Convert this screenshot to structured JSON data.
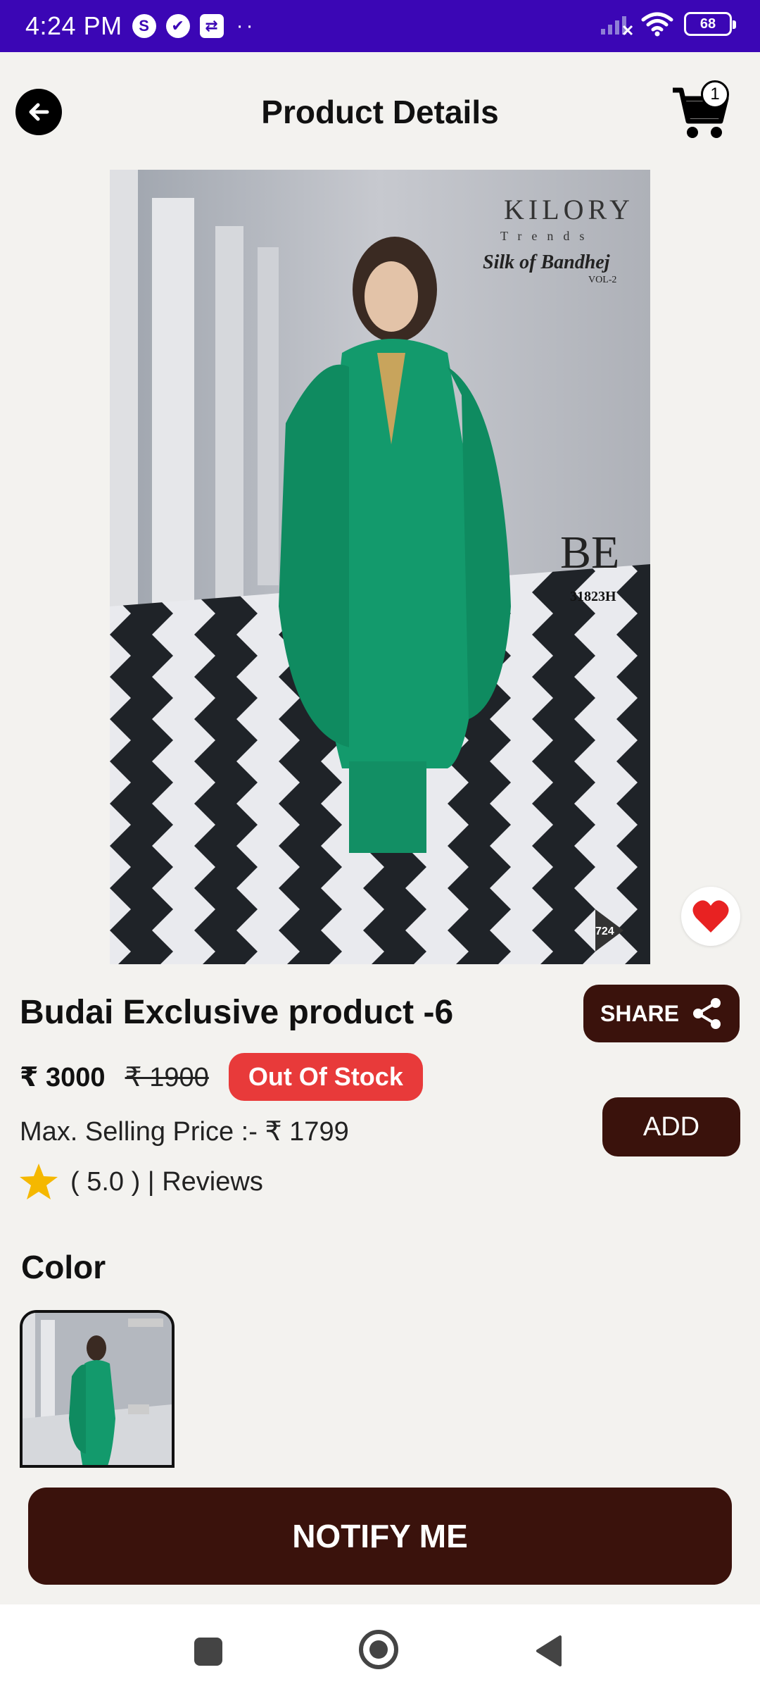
{
  "status_bar": {
    "time": "4:24 PM",
    "notification_icons": [
      "S",
      "✔",
      "⇄"
    ],
    "overflow": "··",
    "battery": "68"
  },
  "header": {
    "title": "Product Details",
    "cart_count": "1"
  },
  "product": {
    "image_brand": "KILORY",
    "image_brand_sub": "Trends",
    "image_collection": "Silk of Bandhej",
    "image_volume": "VOL-2",
    "image_logo": "BE",
    "image_code": "31823H",
    "image_page": "724",
    "name": "Budai Exclusive product -6",
    "price": "₹ 3000",
    "old_price": "₹ 1900",
    "stock_status": "Out Of Stock",
    "max_selling_price": "Max. Selling Price :- ₹ 1799",
    "rating_text": "( 5.0 ) | Reviews"
  },
  "actions": {
    "share_label": "SHARE",
    "add_label": "ADD",
    "notify_label": "NOTIFY ME"
  },
  "color_section": {
    "title": "Color"
  },
  "colors": {
    "accent": "#3a120c",
    "status_bar": "#3b06b5",
    "badge": "#e83a3a",
    "star": "#f5b800",
    "heart": "#e82222"
  }
}
